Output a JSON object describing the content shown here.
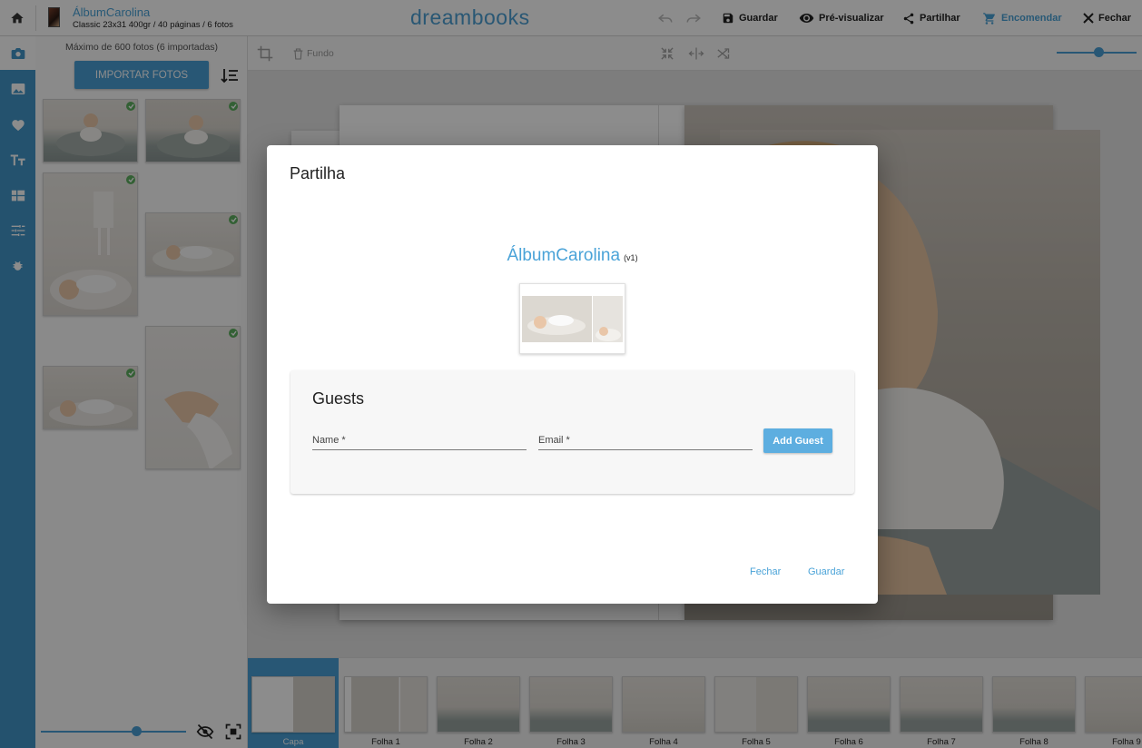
{
  "topbar": {
    "album_title": "ÁlbumCarolina",
    "album_subtitle": "Classic 23x31 400gr / 40 páginas / 6 fotos",
    "brand": "dreambooks",
    "save_label": "Guardar",
    "preview_label": "Pré-visualizar",
    "share_label": "Partilhar",
    "order_label": "Encomendar",
    "close_label": "Fechar",
    "accent_color": "#4aa3d8"
  },
  "rail": {
    "items": [
      "camera-icon",
      "image-icon",
      "heart-icon",
      "text-size-icon",
      "layout-icon",
      "adjust-icon",
      "bug-icon"
    ]
  },
  "photo_panel": {
    "caption": "Máximo de 600 fotos (6 importadas)",
    "import_label": "IMPORTAR FOTOS"
  },
  "toolbar": {
    "background_label": "Fundo"
  },
  "filmstrip": {
    "items": [
      "Capa",
      "Folha 1",
      "Folha 2",
      "Folha 3",
      "Folha 4",
      "Folha 5",
      "Folha 6",
      "Folha 7",
      "Folha 8",
      "Folha 9"
    ]
  },
  "modal": {
    "title": "Partilha",
    "album_name": "ÁlbumCarolina",
    "album_version": "(v1)",
    "guests_title": "Guests",
    "name_label": "Name *",
    "email_label": "Email *",
    "add_guest_label": "Add Guest",
    "close_label": "Fechar",
    "save_label": "Guardar"
  }
}
